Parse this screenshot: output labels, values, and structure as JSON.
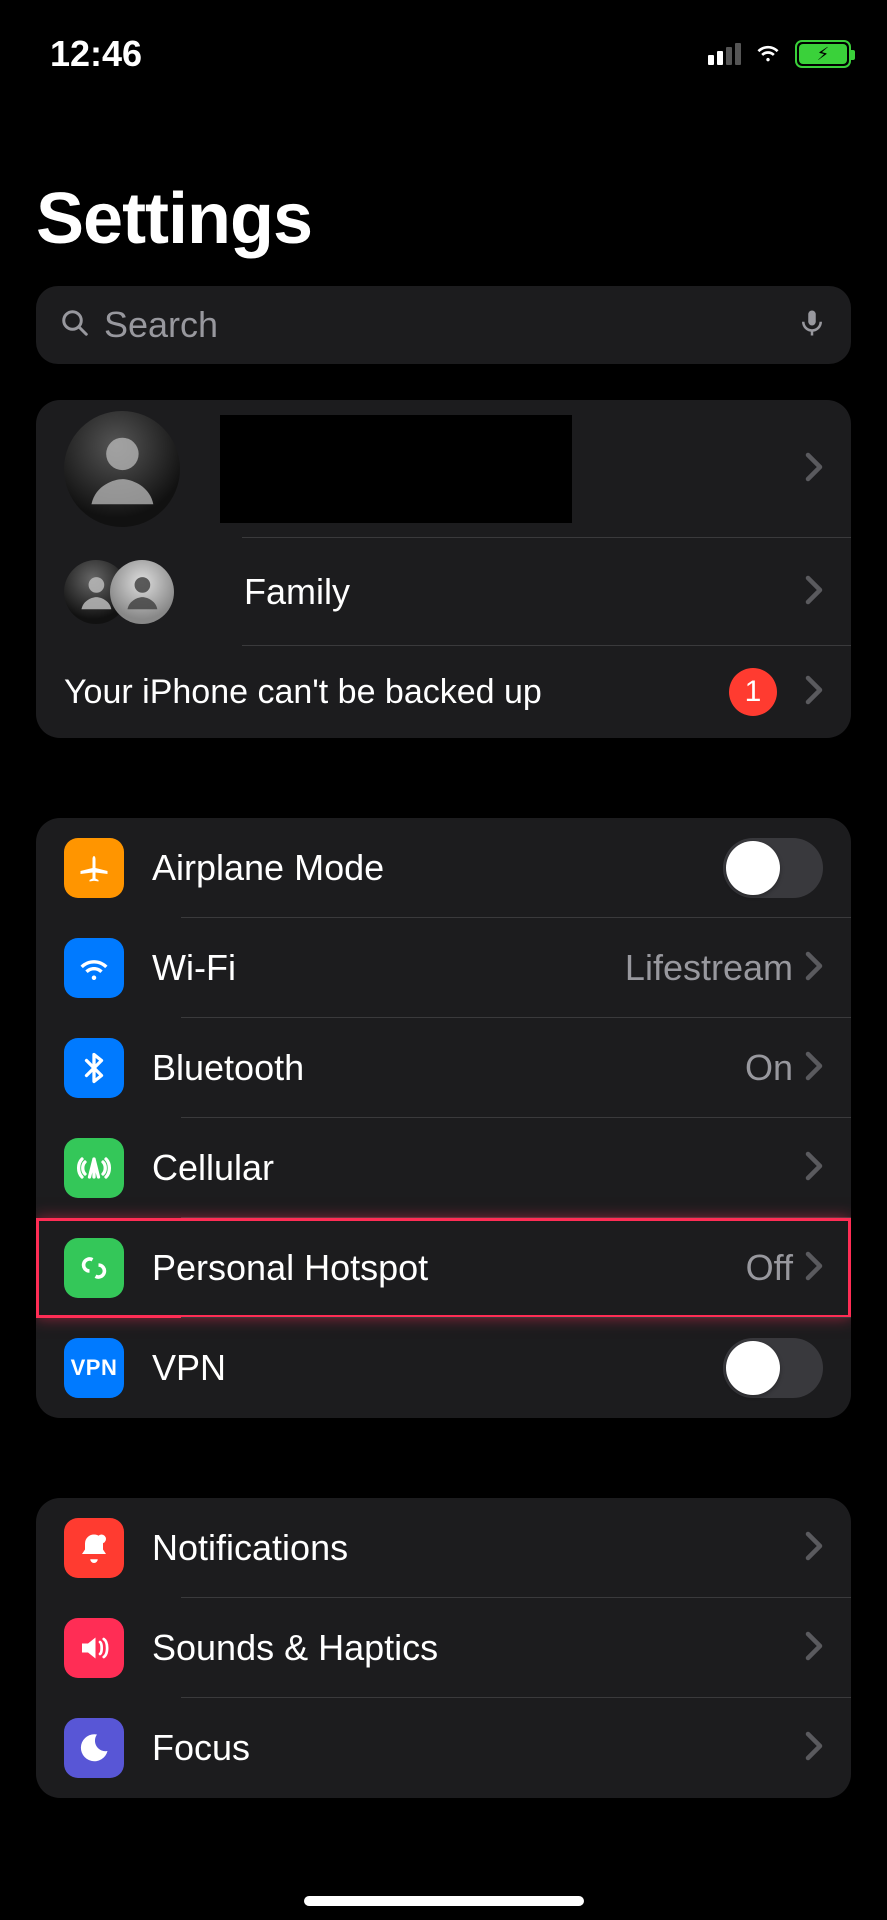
{
  "status": {
    "time": "12:46"
  },
  "title": "Settings",
  "search": {
    "placeholder": "Search"
  },
  "account": {
    "family_label": "Family",
    "backup_warning": "Your iPhone can't be backed up",
    "badge_count": "1"
  },
  "connectivity": {
    "airplane_mode": {
      "label": "Airplane Mode"
    },
    "wifi": {
      "label": "Wi-Fi",
      "value": "Lifestream"
    },
    "bluetooth": {
      "label": "Bluetooth",
      "value": "On"
    },
    "cellular": {
      "label": "Cellular"
    },
    "hotspot": {
      "label": "Personal Hotspot",
      "value": "Off"
    },
    "vpn": {
      "label": "VPN"
    }
  },
  "general": {
    "notifications": {
      "label": "Notifications"
    },
    "sounds": {
      "label": "Sounds & Haptics"
    },
    "focus": {
      "label": "Focus"
    }
  }
}
